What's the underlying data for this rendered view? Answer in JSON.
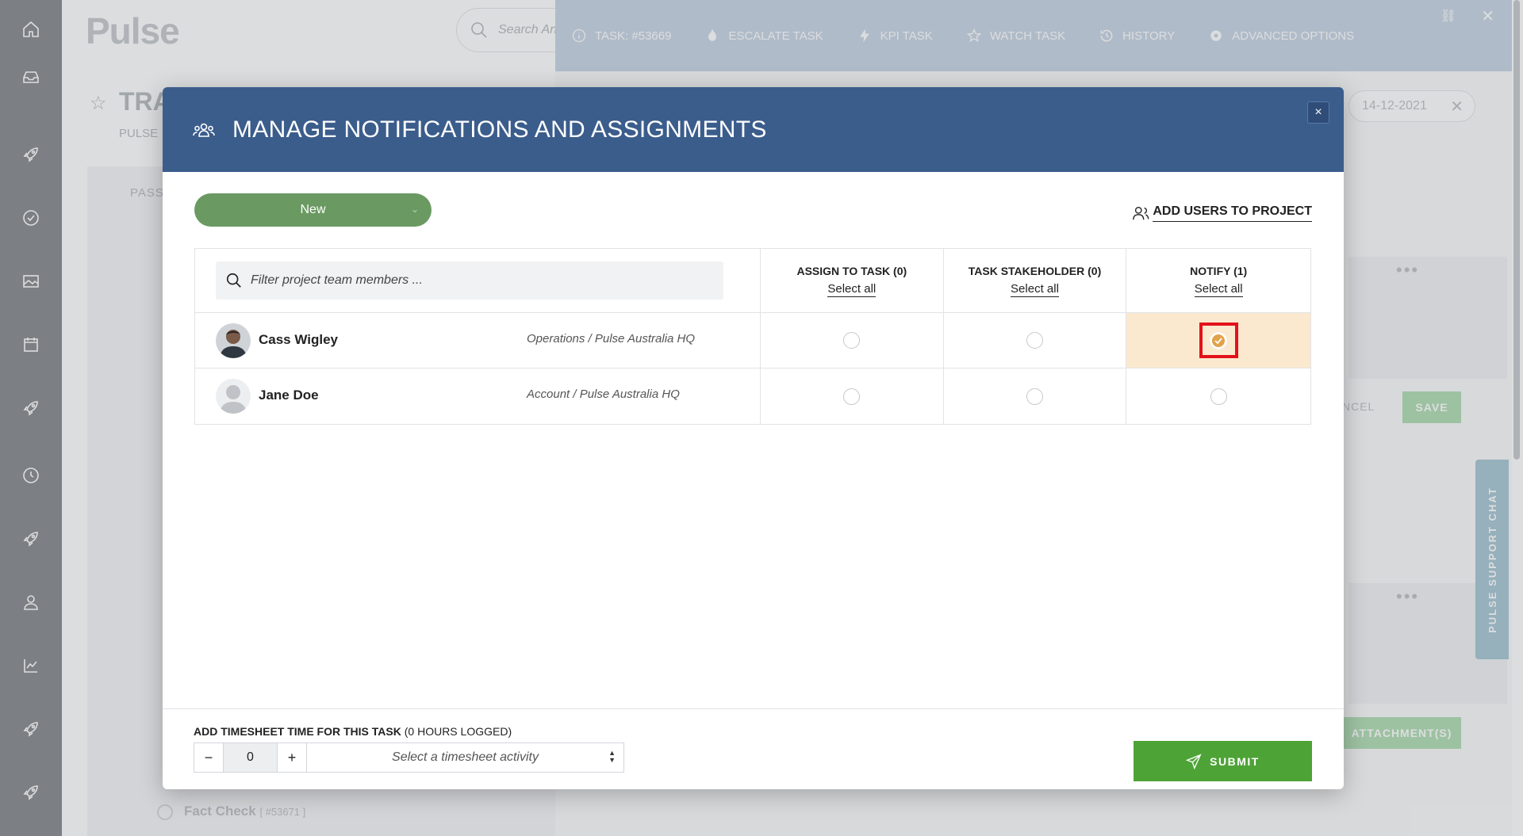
{
  "background": {
    "logo": "Pulse",
    "search_placeholder": "Search Any",
    "page_title": "TRA",
    "page_subtitle": "PULSE",
    "tab_text": "PASS",
    "fact_check_label": "Fact Check",
    "fact_check_id": "[ #53671 ]",
    "date_value": "14-12-2021",
    "cancel_label": "NCEL",
    "save_label": "SAVE",
    "attachment_label": "ATTACHMENT(S)",
    "support_chat": "PULSE SUPPORT CHAT"
  },
  "task_toolbar": {
    "task_id": "TASK: #53669",
    "escalate": "ESCALATE TASK",
    "kpi": "KPI TASK",
    "watch": "WATCH TASK",
    "history": "HISTORY",
    "advanced": "ADVANCED OPTIONS"
  },
  "modal": {
    "title": "MANAGE NOTIFICATIONS AND ASSIGNMENTS",
    "close": "×",
    "status_value": "New",
    "add_users": "ADD USERS TO PROJECT",
    "filter_placeholder": "Filter project team members ...",
    "columns": [
      {
        "label": "ASSIGN TO TASK (0)",
        "select_all": "Select all"
      },
      {
        "label": "TASK STAKEHOLDER (0)",
        "select_all": "Select all"
      },
      {
        "label": "NOTIFY (1)",
        "select_all": "Select all"
      }
    ],
    "users": [
      {
        "name": "Cass Wigley",
        "dept": "Operations / Pulse Australia HQ",
        "assign": false,
        "stakeholder": false,
        "notify": true
      },
      {
        "name": "Jane Doe",
        "dept": "Account / Pulse Australia HQ",
        "assign": false,
        "stakeholder": false,
        "notify": false
      }
    ],
    "timesheet": {
      "label_bold": "ADD TIMESHEET TIME FOR THIS TASK",
      "label_rest": "(0 HOURS LOGGED)",
      "minus": "−",
      "value": "0",
      "plus": "+",
      "activity_placeholder": "Select a timesheet activity"
    },
    "submit": "SUBMIT"
  },
  "colors": {
    "header": "#3b5d8c",
    "status_green": "#6a9a62",
    "submit_green": "#4ea337",
    "notify_highlight": "#fbe9cf",
    "checked_orange": "#e2a24a",
    "focus_red": "#e3111b"
  }
}
